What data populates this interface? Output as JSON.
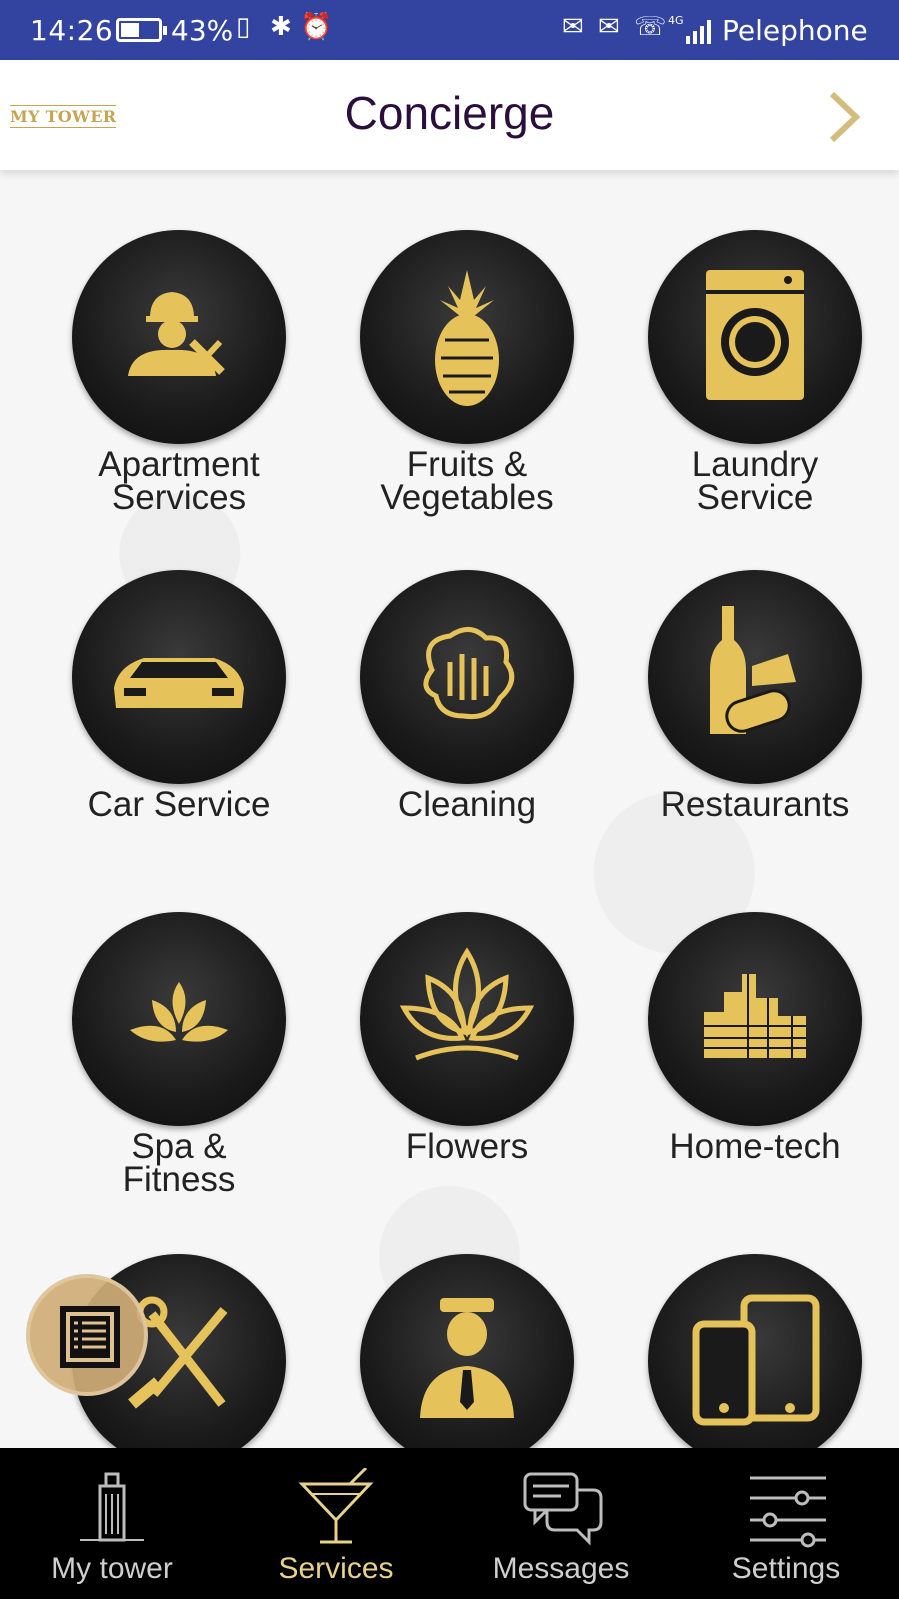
{
  "status_bar": {
    "time": "14:26",
    "battery_percent": "43%",
    "carrier": "Pelephone",
    "network": "4G"
  },
  "header": {
    "logo": "MY TOWER",
    "title": "Concierge"
  },
  "services": [
    {
      "label_line1": "Apartment",
      "label_line2": "Services",
      "icon": "handyman-icon"
    },
    {
      "label_line1": "Fruits &",
      "label_line2": "Vegetables",
      "icon": "pineapple-icon"
    },
    {
      "label_line1": "Laundry",
      "label_line2": "Service",
      "icon": "washing-machine-icon"
    },
    {
      "label_line1": "Car Service",
      "label_line2": "",
      "icon": "car-icon"
    },
    {
      "label_line1": "Cleaning",
      "label_line2": "",
      "icon": "cleaning-glove-icon"
    },
    {
      "label_line1": "Restaurants",
      "label_line2": "",
      "icon": "wine-cheese-icon"
    },
    {
      "label_line1": "Spa &",
      "label_line2": "Fitness",
      "icon": "lotus-icon"
    },
    {
      "label_line1": "Flowers",
      "label_line2": "",
      "icon": "flower-icon"
    },
    {
      "label_line1": "Home-tech",
      "label_line2": "",
      "icon": "buildings-icon"
    },
    {
      "label_line1": "",
      "label_line2": "",
      "icon": "tools-icon"
    },
    {
      "label_line1": "",
      "label_line2": "",
      "icon": "doorman-icon"
    },
    {
      "label_line1": "",
      "label_line2": "",
      "icon": "devices-icon"
    }
  ],
  "bottom_nav": [
    {
      "label": "My tower",
      "icon": "tower-icon",
      "active": false
    },
    {
      "label": "Services",
      "icon": "cocktail-icon",
      "active": true
    },
    {
      "label": "Messages",
      "icon": "chat-bubbles-icon",
      "active": false
    },
    {
      "label": "Settings",
      "icon": "sliders-icon",
      "active": false
    }
  ],
  "colors": {
    "status_bar": "#3343a0",
    "gold": "#e6c35a",
    "title": "#2a0f3d",
    "nav_active": "#e7d28c"
  }
}
